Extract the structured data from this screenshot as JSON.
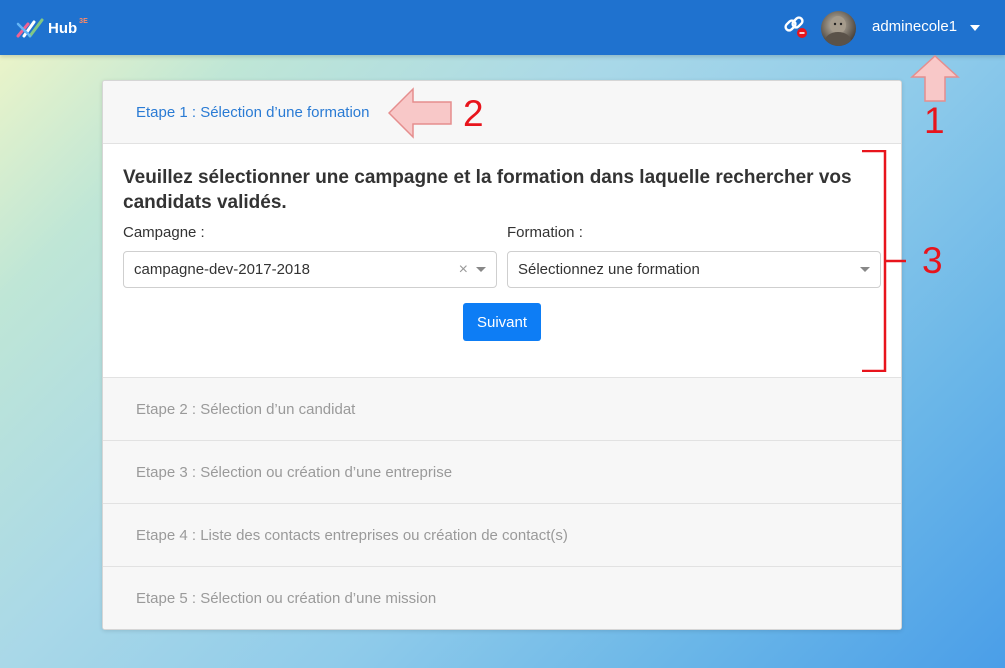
{
  "navbar": {
    "logo_text": "Hub",
    "logo_superscript": "3E",
    "username": "adminecole1"
  },
  "steps": [
    {
      "label": "Etape 1 : Sélection d’une formation",
      "state": "active"
    },
    {
      "label": "Etape 2 : Sélection d’un candidat",
      "state": "disabled"
    },
    {
      "label": "Etape 3 : Sélection ou création d’une entreprise",
      "state": "disabled"
    },
    {
      "label": "Etape 4 : Liste des contacts entreprises ou création de contact(s)",
      "state": "disabled"
    },
    {
      "label": "Etape 5 : Sélection ou création d’une mission",
      "state": "disabled"
    }
  ],
  "form": {
    "title": "Veuillez sélectionner une campagne et la formation dans laquelle rechercher vos candidats validés.",
    "campagne_label": "Campagne :",
    "campagne_value": "campagne-dev-2017-2018",
    "formation_label": "Formation :",
    "formation_placeholder": "Sélectionnez une formation",
    "submit_label": "Suivant"
  },
  "annotations": {
    "marker_1": "1",
    "marker_2": "2",
    "marker_3": "3"
  },
  "colors": {
    "navbar": "#1f72cf",
    "primary": "#0d7df5",
    "active_step": "#2a7bd4",
    "annotation": "#e8141c"
  }
}
